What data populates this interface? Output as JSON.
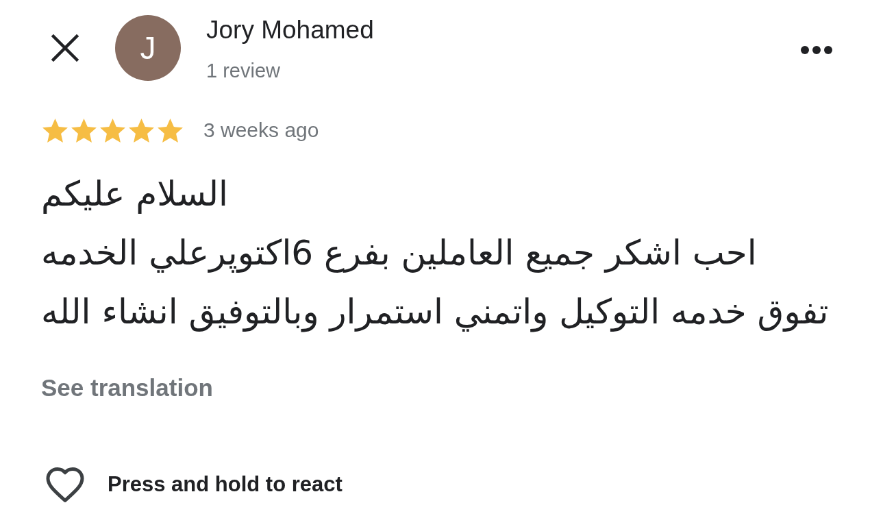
{
  "author": {
    "initial": "J",
    "name": "Jory Mohamed",
    "review_count": "1 review"
  },
  "rating": {
    "stars": 5,
    "time": "3 weeks ago"
  },
  "review_text": "السلام عليكم\nاحب اشكر جميع العاملين بفرع 6اكتوپرعلي الخدمه\nتفوق خدمه التوكيل واتمني استمرار وبالتوفيق انشاء الله",
  "translation_link": "See translation",
  "reaction": {
    "reacted": false,
    "hint": "Press and hold to react"
  }
}
